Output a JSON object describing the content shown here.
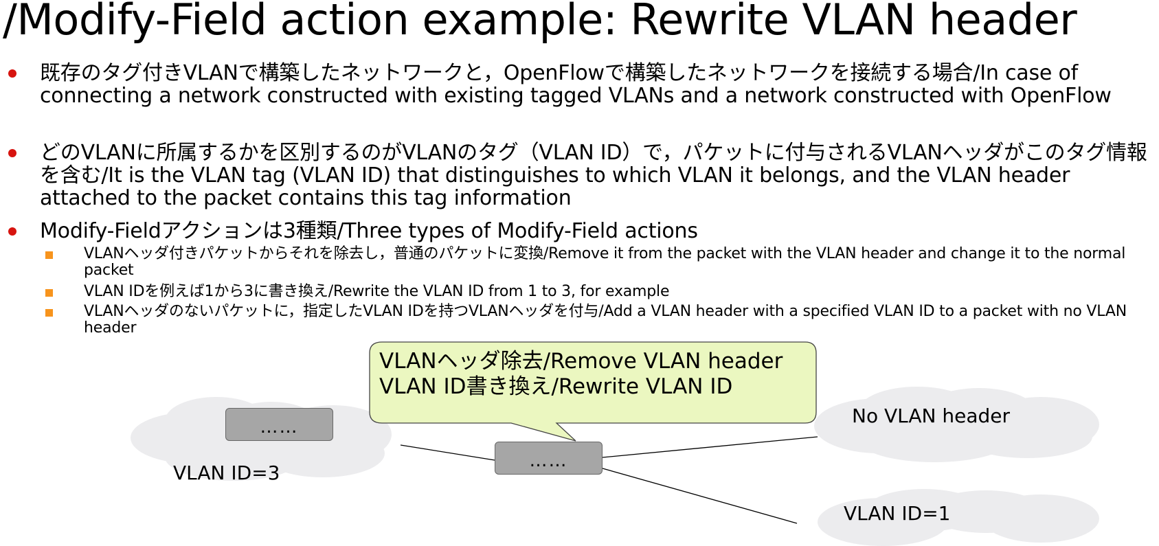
{
  "slide": {
    "title": "/Modify-Field action example: Rewrite VLAN header"
  },
  "bullets": [
    {
      "text": "既存のタグ付きVLANで構築したネットワークと，OpenFlowで構築したネットワークを接続する場合/In case of connecting a network constructed with existing tagged VLANs and a network constructed with OpenFlow"
    },
    {
      "text": "どのVLANに所属するかを区別するのがVLANのタグ（VLAN ID）で，パケットに付与されるVLANヘッダがこのタグ情報を含む/It is the VLAN tag (VLAN ID) that distinguishes to which VLAN it belongs, and the VLAN header attached to the packet contains this tag information"
    },
    {
      "text": "Modify-Fieldアクションは3種類/Three types of Modify-Field actions",
      "subitems": [
        "VLANヘッダ付きパケットからそれを除去し，普通のパケットに変換/Remove it from the packet with the VLAN header and change it to the normal packet",
        "VLAN IDを例えば1から3に書き換え/Rewrite the VLAN ID from 1 to 3, for example",
        "VLANヘッダのないパケットに，指定したVLAN IDを持つVLANヘッダを付与/Add a VLAN header with a specified VLAN ID to a packet with no VLAN header"
      ]
    }
  ],
  "diagram": {
    "callout_lines": [
      "VLANヘッダ除去/Remove VLAN header",
      "VLAN ID書き換え/Rewrite VLAN ID"
    ],
    "left_switch_label": "……",
    "center_switch_label": "……",
    "left_cloud_label": "VLAN ID=3",
    "right_top_cloud_label": "No VLAN header",
    "right_bottom_cloud_label": "VLAN ID=1"
  },
  "colors": {
    "bullet": "#d7140f",
    "subbullet": "#f7941d",
    "callout_fill": "#ebf7c0",
    "cloud_fill": "#ececee",
    "switch_fill": "#a6a6a6"
  },
  "icons": {
    "bullet": "red-dot-icon",
    "subbullet": "orange-square-icon"
  }
}
